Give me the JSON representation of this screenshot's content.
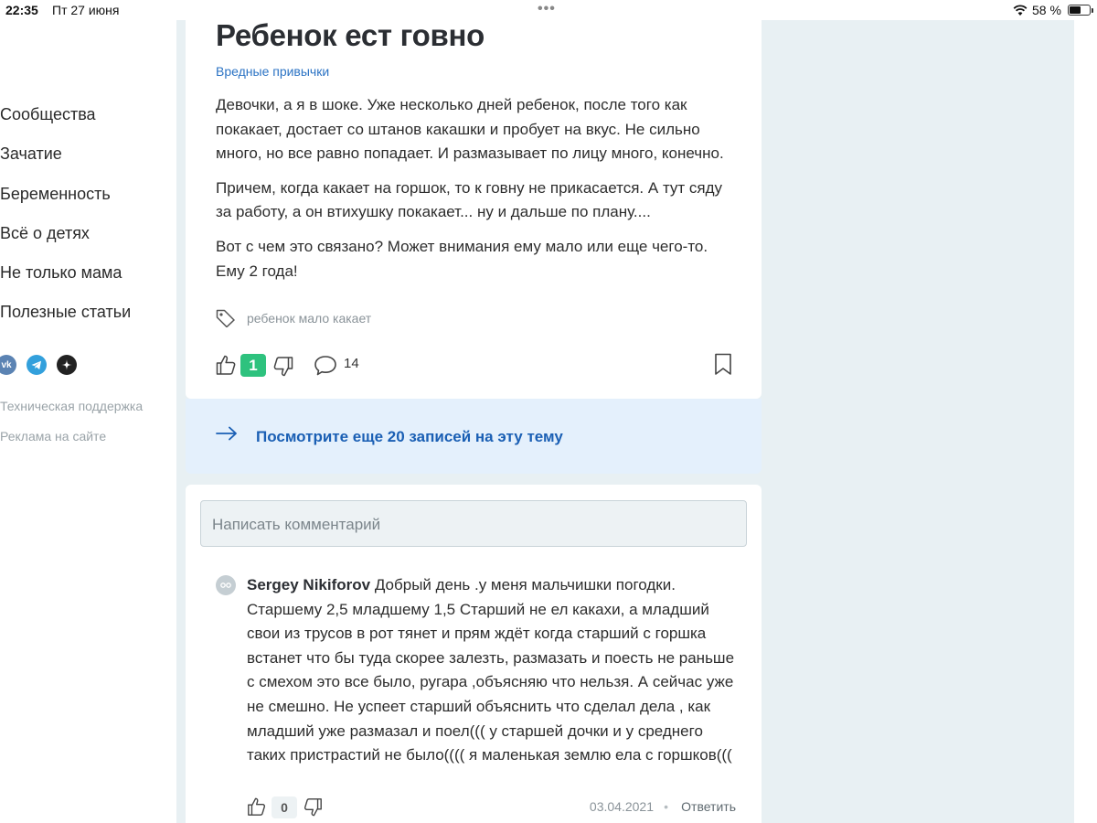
{
  "status_bar": {
    "time": "22:35",
    "date": "Пт 27 июня",
    "battery": "58 %",
    "battery_level": 0.58
  },
  "sidebar": {
    "items": [
      {
        "label": "Сообщества"
      },
      {
        "label": "Зачатие"
      },
      {
        "label": "Беременность"
      },
      {
        "label": "Всё о детях"
      },
      {
        "label": "Не только мама"
      },
      {
        "label": "Полезные статьи"
      }
    ],
    "socials": [
      "vk-icon",
      "telegram-icon",
      "dzen-icon"
    ],
    "footer": {
      "support": "Техническая поддержка",
      "ads": "Реклама на сайте"
    }
  },
  "post": {
    "title": "Ребенок ест говно",
    "category": "Вредные привычки",
    "paragraphs": [
      "Девочки, а я в шоке. Уже несколько дней ребенок, после того как покакает, достает со штанов какашки и пробует на вкус. Не сильно много, но все равно попадает. И размазывает по лицу много, конечно.",
      "Причем, когда какает на горшок, то к говну не прикасается. А тут сяду за работу, а он втихушку покакает... ну и дальше по плану....",
      "Вот с чем это связано? Может внимания ему мало или еще чего-то. Ему 2 года!"
    ],
    "tag": "ребенок мало какает",
    "likes": "1",
    "comments_count": "14"
  },
  "more": {
    "text": "Посмотрите еще 20 записей на эту тему"
  },
  "comments": {
    "input_placeholder": "Написать комментарий",
    "items": [
      {
        "author": "Sergey Nikiforov",
        "text": "Добрый день .у меня мальчишки погодки. Старшему 2,5 младшему 1,5 Старший не ел какахи, а младший свои из трусов в рот тянет и прям ждёт когда старший с горшка встанет что бы туда скорее залезть, размазать и поесть не раньше с смехом это все было, ругара ,объясняю что нельзя. А сейчас уже не смешно. Не успеет старший объяснить что сделал дела , как младший уже размазал и поел((( у старшей дочки и у среднего таких пристрастий не было(((( я маленькая землю ела с горшков(((",
        "likes": "0",
        "date": "03.04.2021",
        "reply": "Ответить"
      }
    ]
  },
  "colors": {
    "accent_blue": "#1a5fb4",
    "like_green": "#2ec27e",
    "page_bg": "#e8f0f3",
    "banner_bg": "#e4f0fc"
  }
}
